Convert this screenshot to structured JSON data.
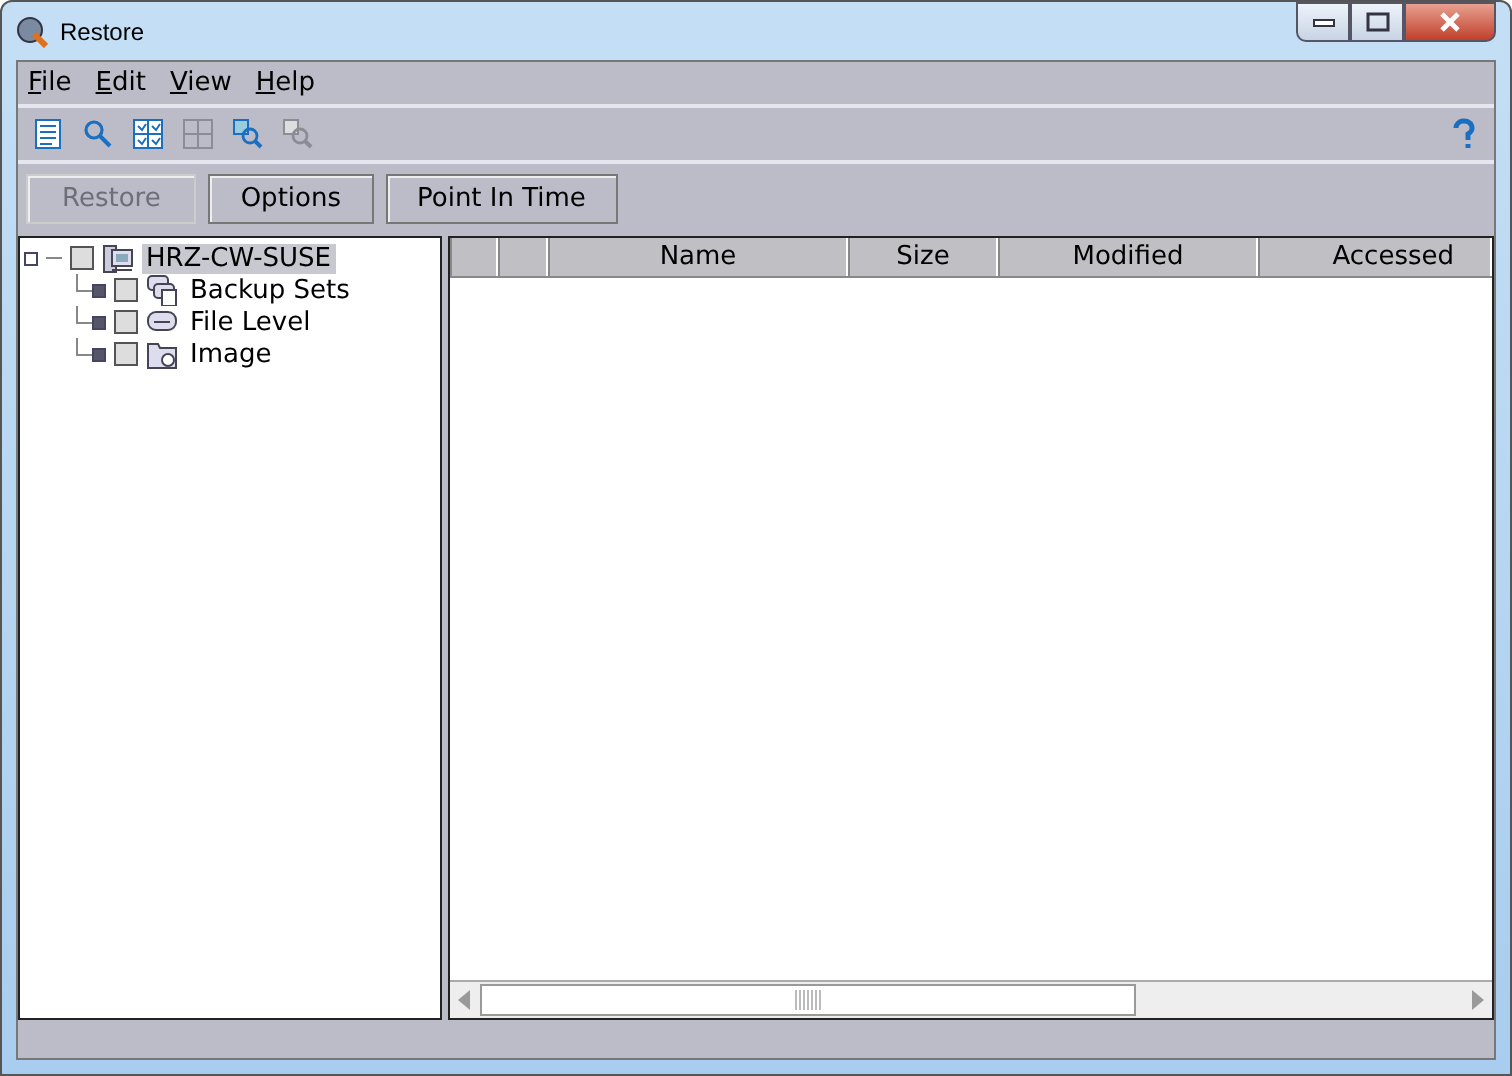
{
  "window": {
    "title": "Restore"
  },
  "menu": [
    "File",
    "Edit",
    "View",
    "Help"
  ],
  "toolbar": [
    {
      "kind": "list",
      "disabled": false
    },
    {
      "kind": "search",
      "disabled": false
    },
    {
      "kind": "checkgrid",
      "disabled": false
    },
    {
      "kind": "grid",
      "disabled": true
    },
    {
      "kind": "find",
      "disabled": false
    },
    {
      "kind": "find",
      "disabled": true
    }
  ],
  "buttons": [
    {
      "label": "Restore",
      "disabled": true
    },
    {
      "label": "Options",
      "disabled": false
    },
    {
      "label": "Point In Time",
      "disabled": false
    }
  ],
  "tree": [
    {
      "label": "HRZ-CW-SUSE",
      "kind": "computer",
      "checked": false,
      "selected": true,
      "children": [
        {
          "label": "Backup Sets",
          "kind": "sets",
          "checked": false,
          "selected": false
        },
        {
          "label": "File Level",
          "kind": "drive",
          "checked": false,
          "selected": false
        },
        {
          "label": "Image",
          "kind": "image",
          "checked": false,
          "selected": false
        }
      ]
    }
  ],
  "table": {
    "columns": [
      "Name",
      "Size",
      "Modified",
      "Accessed"
    ]
  }
}
